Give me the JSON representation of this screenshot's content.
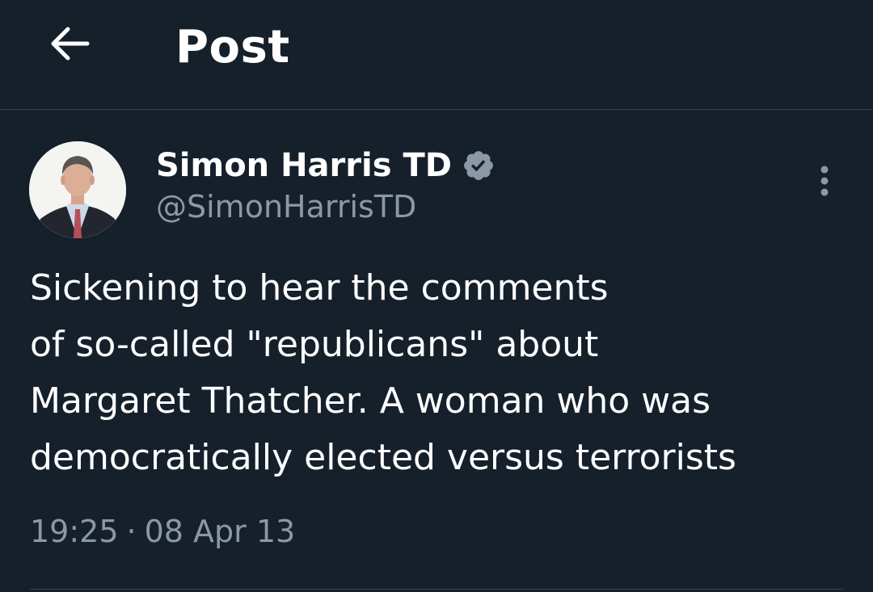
{
  "header": {
    "title": "Post",
    "back_icon": "arrow-left-icon"
  },
  "post": {
    "author": {
      "name": "Simon Harris TD",
      "handle": "@SimonHarrisTD",
      "verified": true,
      "badge_color": "#8b98a5"
    },
    "text": "Sickening to hear the comments\nof so-called \"republicans\" about\nMargaret Thatcher. A woman who was\ndemocratically elected versus terrorists",
    "time": "19:25",
    "separator": "·",
    "date": "08 Apr 13"
  },
  "colors": {
    "background": "#15202b",
    "primary_text": "#ffffff",
    "secondary_text": "#8b98a5",
    "border": "#38444d"
  }
}
